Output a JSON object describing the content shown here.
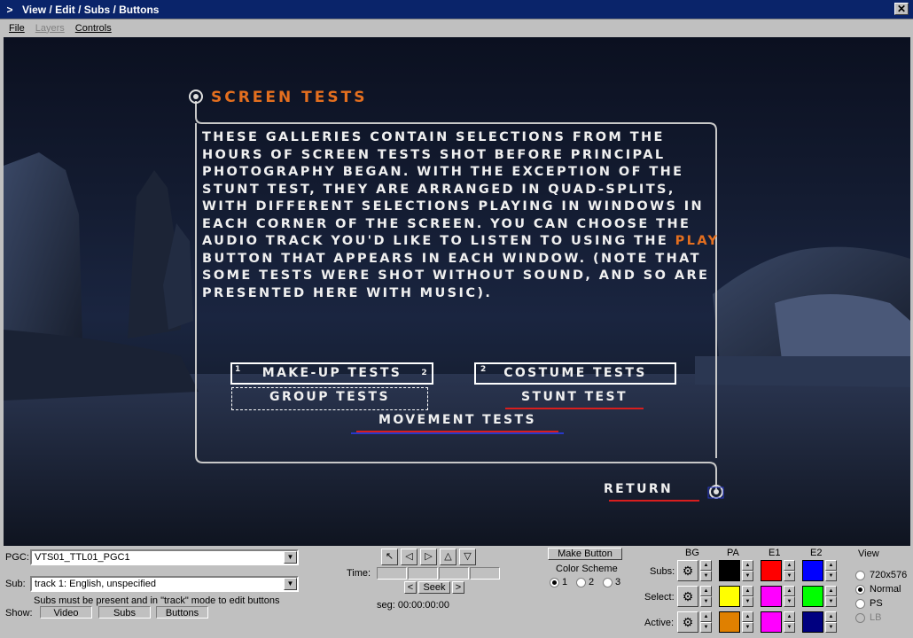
{
  "window": {
    "title": "View / Edit / Subs / Buttons",
    "sys_icon": ">",
    "close_glyph": "✕"
  },
  "menu": [
    {
      "label": "File",
      "enabled": true
    },
    {
      "label": "Layers",
      "enabled": false
    },
    {
      "label": "Controls",
      "enabled": true
    }
  ],
  "dvd_menu": {
    "title": "SCREEN TESTS",
    "body_parts": [
      "THESE GALLERIES CONTAIN SELECTIONS FROM THE HOURS OF SCREEN TESTS SHOT BEFORE PRINCIPAL PHOTOGRAPHY BEGAN. WITH THE EXCEPTION OF THE STUNT TEST, THEY ARE ARRANGED IN QUAD-SPLITS, WITH DIFFERENT SELECTIONS PLAYING IN WINDOWS IN EACH CORNER OF THE SCREEN. YOU CAN CHOOSE THE AUDIO TRACK YOU'D LIKE TO LISTEN TO USING THE ",
      "PLAY",
      " BUTTON THAT APPEARS IN EACH WINDOW. (NOTE THAT SOME TESTS WERE SHOT WITHOUT SOUND, AND SO ARE PRESENTED HERE WITH MUSIC)."
    ],
    "buttons": {
      "makeup": "MAKE-UP TESTS",
      "costume": "COSTUME TESTS",
      "group": "GROUP TESTS",
      "stunt": "STUNT TEST",
      "movement": "MOVEMENT TESTS",
      "return": "RETURN"
    },
    "button_markers": {
      "makeup_left": "1",
      "makeup_right": "2",
      "costume_left": "2"
    },
    "colors": {
      "title": "#e46f1f",
      "highlight": "#e46f1f",
      "text": "#f0f0f0",
      "underline_red": "#d81e1e",
      "underline_blue": "#2838c8"
    }
  },
  "panel": {
    "pgc_label": "PGC:",
    "pgc_value": "VTS01_TTL01_PGC1",
    "sub_label": "Sub:",
    "sub_value": "track 1: English, unspecified",
    "sub_note": "Subs must be present and in \"track\" mode to edit buttons",
    "show_label": "Show:",
    "show_buttons": [
      "Video",
      "Subs",
      "Buttons"
    ],
    "time_label": "Time:",
    "seek_label": "Seek",
    "seek_prev": "<",
    "seek_next": ">",
    "seg_text": "seg: 00:00:00:00",
    "make_button": "Make Button",
    "color_scheme_label": "Color Scheme",
    "color_scheme_options": [
      "1",
      "2",
      "3"
    ],
    "color_scheme_selected": "1",
    "columns": [
      "BG",
      "PA",
      "E1",
      "E2"
    ],
    "rows": [
      {
        "label": "Subs:",
        "colors": [
          "#000000",
          "#ff0000",
          "#0000ff"
        ]
      },
      {
        "label": "Select:",
        "colors": [
          "#ffff00",
          "#ff00ff",
          "#00ff00"
        ]
      },
      {
        "label": "Active:",
        "colors": [
          "#e08000",
          "#ff00ff",
          "#000080"
        ]
      }
    ],
    "view_label": "View",
    "view_options": [
      {
        "label": "720x576",
        "state": "off"
      },
      {
        "label": "Normal",
        "state": "on"
      },
      {
        "label": "PS",
        "state": "off"
      },
      {
        "label": "LB",
        "state": "disabled"
      }
    ],
    "tool_icons": [
      "arrow-cursor-icon",
      "left-hand-icon",
      "right-hand-icon",
      "up-hand-icon",
      "down-hand-icon"
    ]
  }
}
